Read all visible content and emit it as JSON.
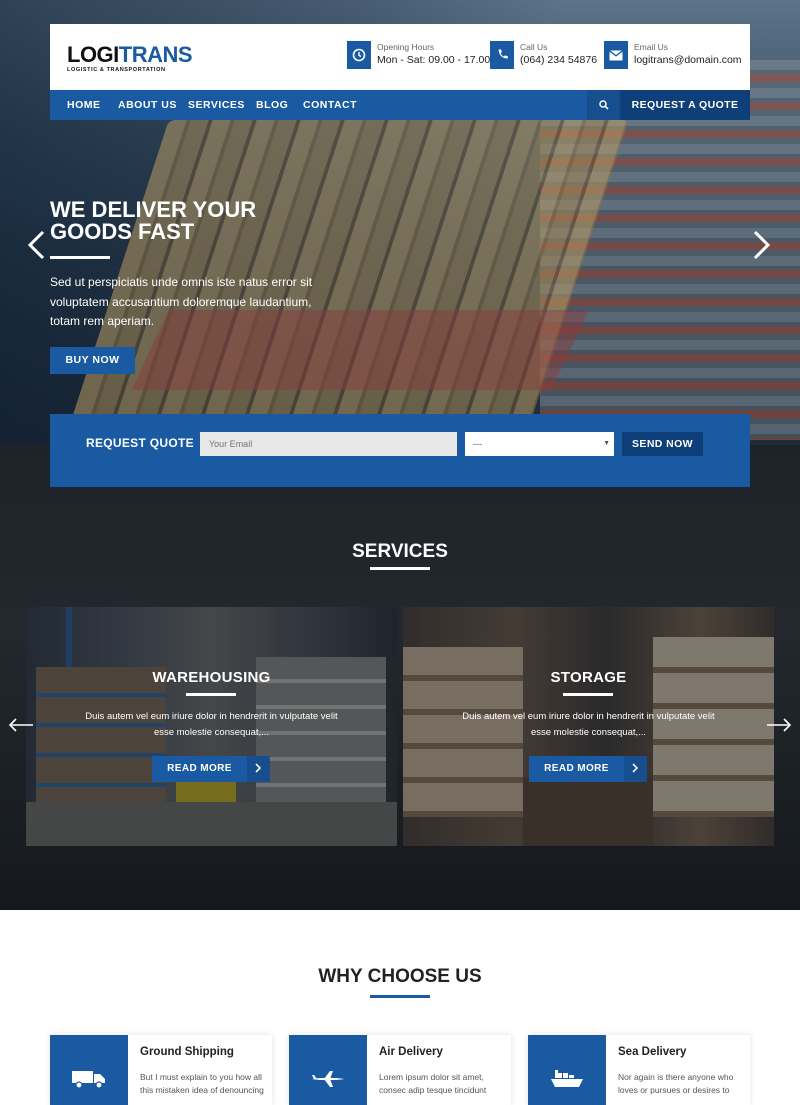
{
  "brand": {
    "name_part1": "LOGI",
    "name_part2": "TRANS",
    "tagline": "LOGISTIC & TRANSPORTATION"
  },
  "header_info": [
    {
      "icon": "clock-icon",
      "label": "Opening Hours",
      "value": "Mon - Sat: 09.00 - 17.00"
    },
    {
      "icon": "phone-icon",
      "label": "Call Us",
      "value": "(064) 234 54876"
    },
    {
      "icon": "mail-icon",
      "label": "Email Us",
      "value": "logitrans@domain.com"
    }
  ],
  "nav": {
    "items": [
      "HOME",
      "ABOUT US",
      "SERVICES",
      "BLOG",
      "CONTACT"
    ],
    "search_icon": "search-icon",
    "quote_button": "REQUEST A QUOTE"
  },
  "hero": {
    "title_line1": "WE DELIVER YOUR",
    "title_line2": "GOODS FAST",
    "text": "Sed ut perspiciatis unde omnis iste natus error sit voluptatem accusantium doloremque laudantium, totam rem aperiam.",
    "button": "BUY NOW",
    "prev_icon": "chevron-left-icon",
    "next_icon": "chevron-right-icon"
  },
  "quote_form": {
    "label": "REQUEST QUOTE",
    "email_placeholder": "Your Email",
    "select_value": "---",
    "button": "SEND NOW"
  },
  "services": {
    "title": "SERVICES",
    "cards": [
      {
        "title": "WAREHOUSING",
        "text": "Duis autem vel eum iriure dolor in hendrerit in vulputate velit esse molestie consequat,...",
        "button": "READ MORE"
      },
      {
        "title": "STORAGE",
        "text": "Duis autem vel eum iriure dolor in hendrerit in vulputate velit esse molestie consequat,...",
        "button": "READ MORE"
      }
    ]
  },
  "why": {
    "title": "WHY CHOOSE US",
    "features": [
      {
        "icon": "truck-icon",
        "title": "Ground Shipping",
        "text": "But I must explain to you how all this mistaken idea of denouncing"
      },
      {
        "icon": "airplane-icon",
        "title": "Air Delivery",
        "text": "Lorem ipsum dolor sit amet, consec adip tesque tincidunt"
      },
      {
        "icon": "ship-icon",
        "title": "Sea Delivery",
        "text": "Nor again is there anyone who loves or pursues or desires to"
      }
    ]
  },
  "colors": {
    "accent": "#1a5aa3",
    "accent_dark": "#0f3f78"
  }
}
